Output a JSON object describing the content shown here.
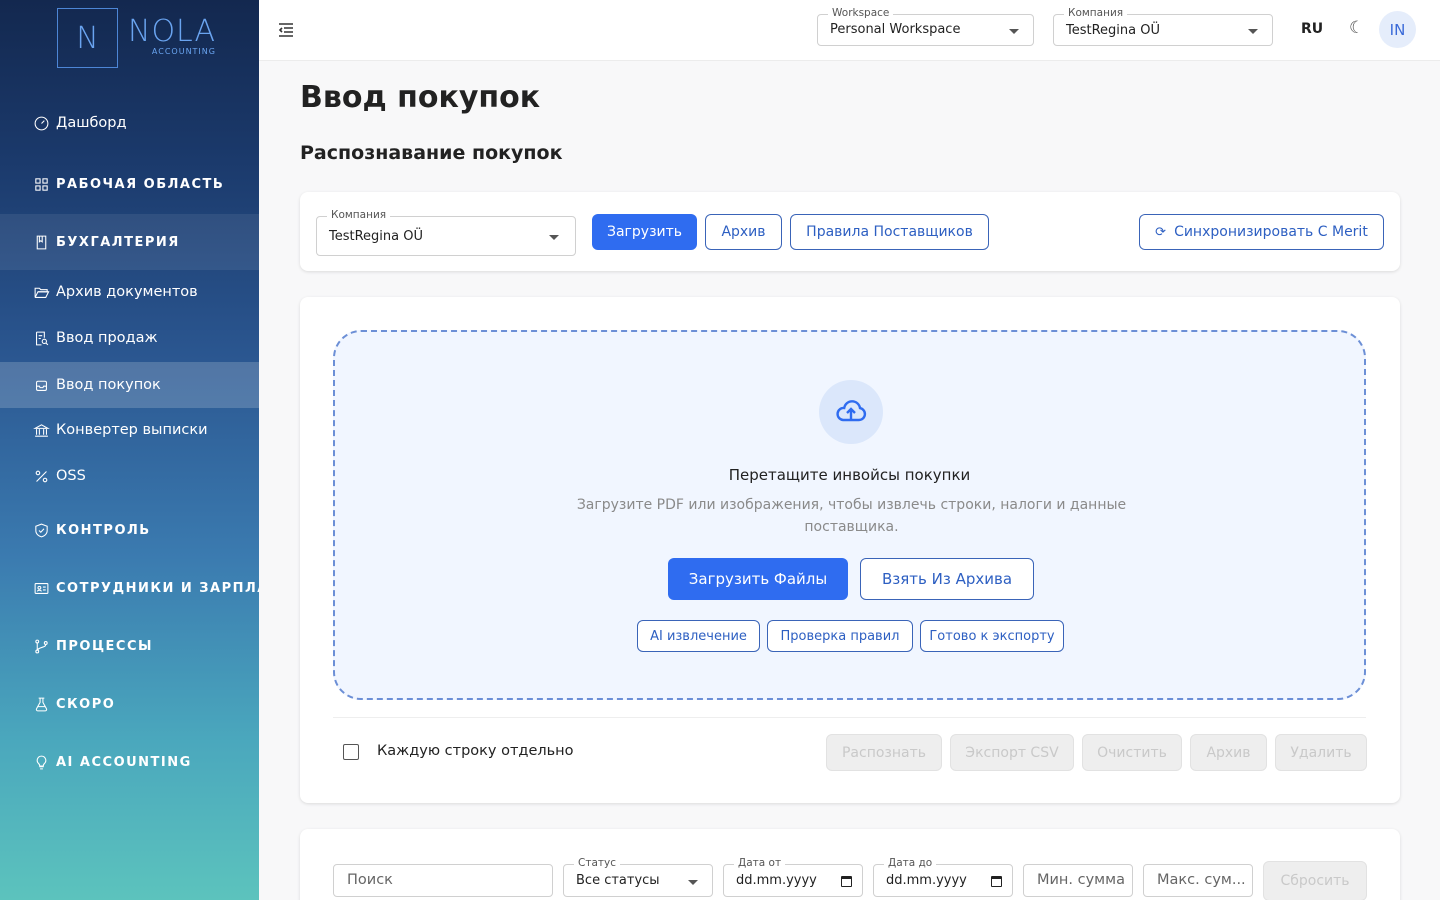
{
  "brand": {
    "letter": "N",
    "name": "NOLA",
    "tagline": "ACCOUNTING"
  },
  "sidebar": {
    "items": [
      {
        "label": "Дашборд",
        "icon": "dashboard-gauge-icon"
      },
      {
        "label": "РАБОЧАЯ ОБЛАСТЬ",
        "icon": "grid-icon"
      },
      {
        "label": "БУХГАЛТЕРИЯ",
        "icon": "book-icon"
      },
      {
        "label": "Архив документов",
        "icon": "folder-open-icon"
      },
      {
        "label": "Ввод продаж",
        "icon": "receipt-search-icon"
      },
      {
        "label": "Ввод покупок",
        "icon": "inbox-icon"
      },
      {
        "label": "Конвертер выписки",
        "icon": "bank-icon"
      },
      {
        "label": "OSS",
        "icon": "percent-icon"
      },
      {
        "label": "КОНТРОЛЬ",
        "icon": "shield-check-icon"
      },
      {
        "label": "СОТРУДНИКИ И ЗАРПЛАТА",
        "icon": "id-card-icon"
      },
      {
        "label": "ПРОЦЕССЫ",
        "icon": "git-branch-icon"
      },
      {
        "label": "СКОРО",
        "icon": "flask-icon"
      },
      {
        "label": "AI ACCOUNTING",
        "icon": "lightbulb-icon"
      }
    ]
  },
  "topbar": {
    "workspace_label": "Workspace",
    "workspace_value": "Personal Workspace",
    "company_label": "Компания",
    "company_value": "TestRegina OÜ",
    "language": "RU",
    "theme_icon": "☾",
    "avatar_initials": "IN"
  },
  "page": {
    "title": "Ввод покупок",
    "section_title": "Распознавание покупок"
  },
  "toolbar": {
    "company_label": "Компания",
    "company_value": "TestRegina OÜ",
    "upload": "Загрузить",
    "archive": "Архив",
    "vendor_rules": "Правила Поставщиков",
    "sync_icon": "⟳",
    "sync": "Синхронизировать С Merit"
  },
  "dropzone": {
    "title": "Перетащите инвойсы покупки",
    "subtitle": "Загрузите PDF или изображения, чтобы извлечь строки, налоги и данные поставщика.",
    "upload_files": "Загрузить Файлы",
    "from_archive": "Взять Из Архива",
    "chips": [
      "AI извлечение",
      "Проверка правил",
      "Готово к экспорту"
    ]
  },
  "actions": {
    "each_line": "Каждую строку отдельно",
    "recognize": "Распознать",
    "export_csv": "Экспорт CSV",
    "clear": "Очистить",
    "archive": "Архив",
    "delete": "Удалить"
  },
  "filters": {
    "search": "Поиск",
    "status_label": "Статус",
    "status_value": "Все статусы",
    "date_from_label": "Дата от",
    "date_from_value": "dd.mm.yyyy",
    "date_to_label": "Дата до",
    "date_to_value": "dd.mm.yyyy",
    "min_sum": "Мин. сумма",
    "max_sum": "Макс. сум...",
    "reset": "Сбросить"
  },
  "colors": {
    "primary": "#2f6cf0",
    "outline": "#3a64b8",
    "dropzone_bg": "#f1f6ff"
  }
}
